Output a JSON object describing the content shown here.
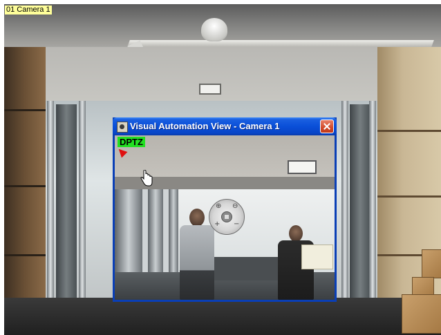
{
  "camera_feed": {
    "label": "01 Camera 1"
  },
  "popup": {
    "title": "Visual Automation View - Camera 1",
    "mode_badge": "DPTZ",
    "icons": {
      "title_icon": "camera-app-icon",
      "close": "close-icon",
      "cursor": "hand-cursor-icon",
      "ptz_control": "ptz-control-icon",
      "direction": "red-arrow-icon"
    },
    "zoom_in_symbol": "⊕",
    "zoom_out_symbol": "⊖",
    "zoom_plus_symbol": "+",
    "zoom_minus_symbol": "−"
  },
  "colors": {
    "titlebar": "#0a4fd8",
    "close_button": "#d14b2a",
    "dptz_badge": "#22e022",
    "camera_label_bg": "#ffff9a"
  }
}
